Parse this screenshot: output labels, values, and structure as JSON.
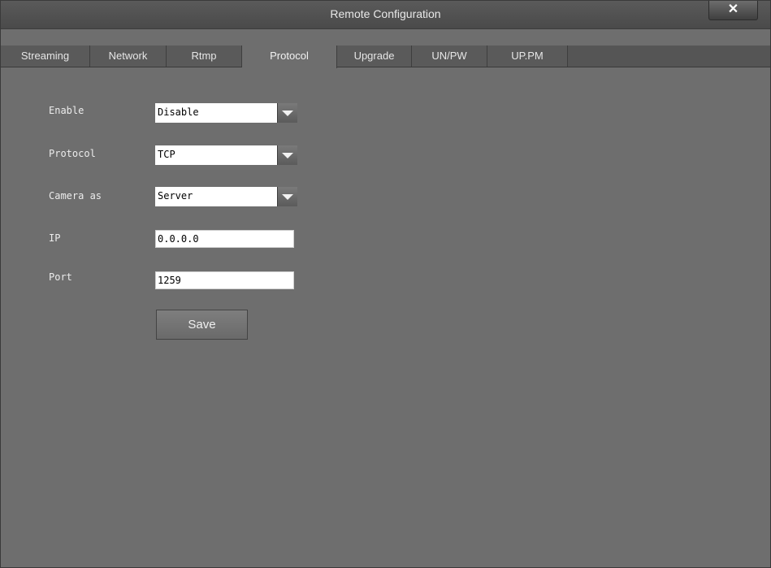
{
  "window": {
    "title": "Remote Configuration",
    "close_label": "✕"
  },
  "tabs": [
    {
      "label": "Streaming"
    },
    {
      "label": "Network"
    },
    {
      "label": "Rtmp"
    },
    {
      "label": "Protocol",
      "active": true
    },
    {
      "label": "Upgrade"
    },
    {
      "label": "UN/PW"
    },
    {
      "label": "UP.PM"
    }
  ],
  "form": {
    "enable": {
      "label": "Enable",
      "value": "Disable"
    },
    "protocol": {
      "label": "Protocol",
      "value": "TCP"
    },
    "camera_as": {
      "label": "Camera as",
      "value": "Server"
    },
    "ip": {
      "label": "IP",
      "value": "0.0.0.0"
    },
    "port": {
      "label": "Port",
      "value": "1259"
    },
    "save_label": "Save"
  }
}
